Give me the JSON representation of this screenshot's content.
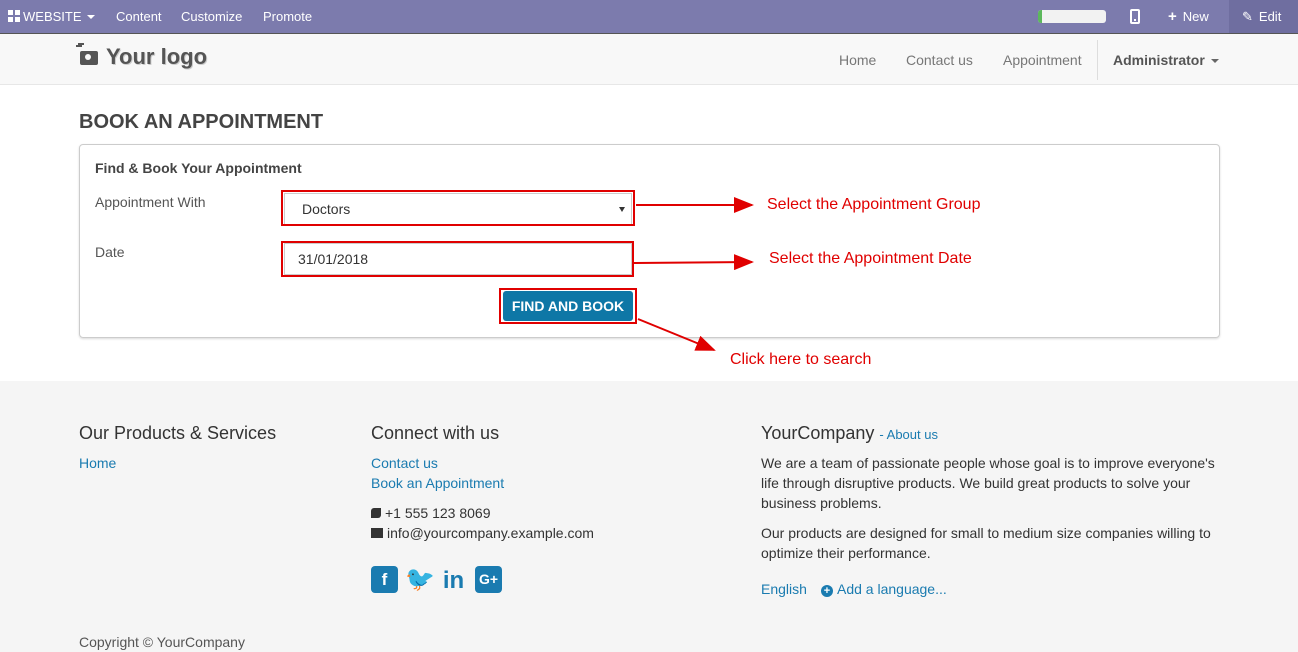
{
  "adminbar": {
    "website_label": "WEBSITE",
    "menu": [
      "Content",
      "Customize",
      "Promote"
    ],
    "progress_fraction": 0.06,
    "new_label": "New",
    "edit_label": "Edit"
  },
  "navbar": {
    "logo_text": "Your logo",
    "links": [
      "Home",
      "Contact us",
      "Appointment"
    ],
    "user_label": "Administrator"
  },
  "main": {
    "page_title": "BOOK AN APPOINTMENT",
    "panel_heading": "Find & Book Your Appointment",
    "appointment_with_label": "Appointment With",
    "appointment_with_value": "Doctors",
    "date_label": "Date",
    "date_value": "31/01/2018",
    "find_button": "FIND AND BOOK"
  },
  "annotations": {
    "group": "Select the Appointment Group",
    "date": "Select the Appointment Date",
    "search": "Click here to search",
    "color": "#e00000"
  },
  "footer": {
    "products_heading": "Our Products & Services",
    "products_links": [
      "Home"
    ],
    "connect_heading": "Connect with us",
    "connect_links": [
      "Contact us",
      "Book an Appointment"
    ],
    "phone": "+1 555 123 8069",
    "email": "info@yourcompany.example.com",
    "social_icons": [
      "facebook-icon",
      "twitter-icon",
      "linkedin-icon",
      "google-plus-icon"
    ],
    "company_name": "YourCompany",
    "about_link": "- About us",
    "about_text_1": "We are a team of passionate people whose goal is to improve everyone's life through disruptive products. We build great products to solve your business problems.",
    "about_text_2": "Our products are designed for small to medium size companies willing to optimize their performance.",
    "language": "English",
    "add_language": "Add a language...",
    "copyright": "Copyright © YourCompany"
  },
  "colors": {
    "admin_bar": "#7c7bad",
    "primary_button": "#0e77a6",
    "link": "#1a7bb0",
    "annotation": "#e00000"
  }
}
